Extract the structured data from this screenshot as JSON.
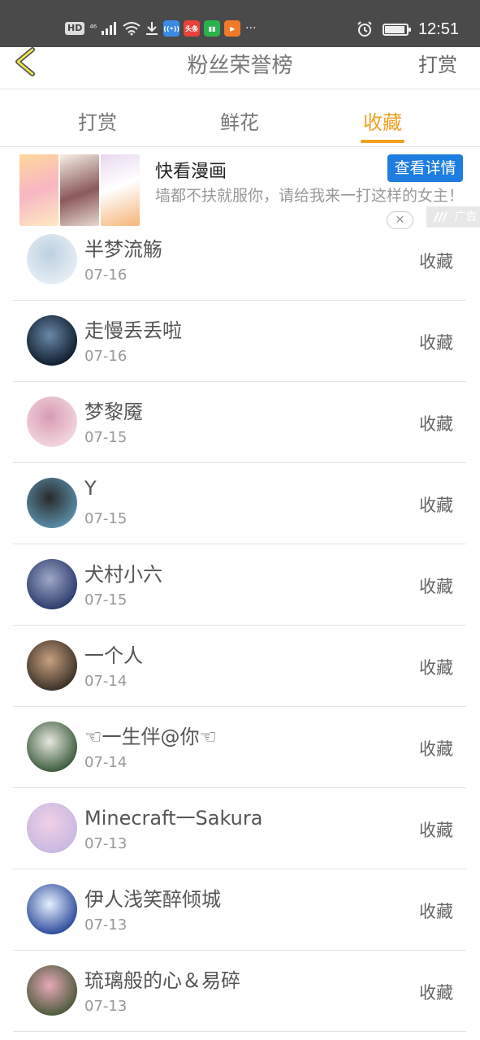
{
  "status_bar": {
    "hd": "HD",
    "network": "⁴⁶",
    "apps": [
      {
        "name": "wifi-assist-app",
        "color": "#3a8be6",
        "label": "((•))"
      },
      {
        "name": "toutiao-app",
        "color": "#e8423a",
        "label": "头条"
      },
      {
        "name": "book-app",
        "color": "#2bb24c",
        "label": "▮▮"
      },
      {
        "name": "video-app",
        "color": "#f07a28",
        "label": "▶"
      }
    ],
    "more": "···",
    "time": "12:51",
    "battery_level": 0.85
  },
  "header": {
    "title": "粉丝荣誉榜",
    "right_action": "打赏",
    "back_icon": "chevron-left-icon"
  },
  "tabs": [
    {
      "label": "打赏",
      "active": false
    },
    {
      "label": "鲜花",
      "active": false
    },
    {
      "label": "收藏",
      "active": true
    }
  ],
  "ad": {
    "title": "快看漫画",
    "button": "查看详情",
    "description": "墙都不扶就服你，请给我来一打这样的女主！",
    "tag": "广告",
    "close_icon": "close-icon",
    "accent": "#1e7de0"
  },
  "fans": [
    {
      "name": "半梦流觞",
      "date": "07-16",
      "action": "收藏",
      "avatar_colors": [
        "#e6eef5",
        "#bcd0e0"
      ]
    },
    {
      "name": "走慢丢丢啦",
      "date": "07-16",
      "action": "收藏",
      "avatar_colors": [
        "#0e1c2c",
        "#6a88a8"
      ]
    },
    {
      "name": "梦黎魇",
      "date": "07-15",
      "action": "收藏",
      "avatar_colors": [
        "#f2d6df",
        "#d89bb2"
      ]
    },
    {
      "name": "Y",
      "date": "07-15",
      "action": "收藏",
      "avatar_colors": [
        "#5a8ea8",
        "#2a2a2a"
      ]
    },
    {
      "name": "犬村小六",
      "date": "07-15",
      "action": "收藏",
      "avatar_colors": [
        "#2a3a6a",
        "#a0a8c8"
      ]
    },
    {
      "name": "一个人",
      "date": "07-14",
      "action": "收藏",
      "avatar_colors": [
        "#3a3026",
        "#c8a080"
      ]
    },
    {
      "name": "☜一生伴@你☜",
      "date": "07-14",
      "action": "收藏",
      "avatar_colors": [
        "#3a5a3a",
        "#e8e8e0"
      ]
    },
    {
      "name": "Minecraft一Sakura",
      "date": "07-13",
      "action": "收藏",
      "avatar_colors": [
        "#c8b8e0",
        "#f0d0e8"
      ]
    },
    {
      "name": "伊人浅笑醉倾城",
      "date": "07-13",
      "action": "收藏",
      "avatar_colors": [
        "#2a4a9a",
        "#e8f0ff"
      ]
    },
    {
      "name": "琉璃般的心＆易碎",
      "date": "07-13",
      "action": "收藏",
      "avatar_colors": [
        "#4a5a3a",
        "#e8a8b8"
      ]
    }
  ]
}
